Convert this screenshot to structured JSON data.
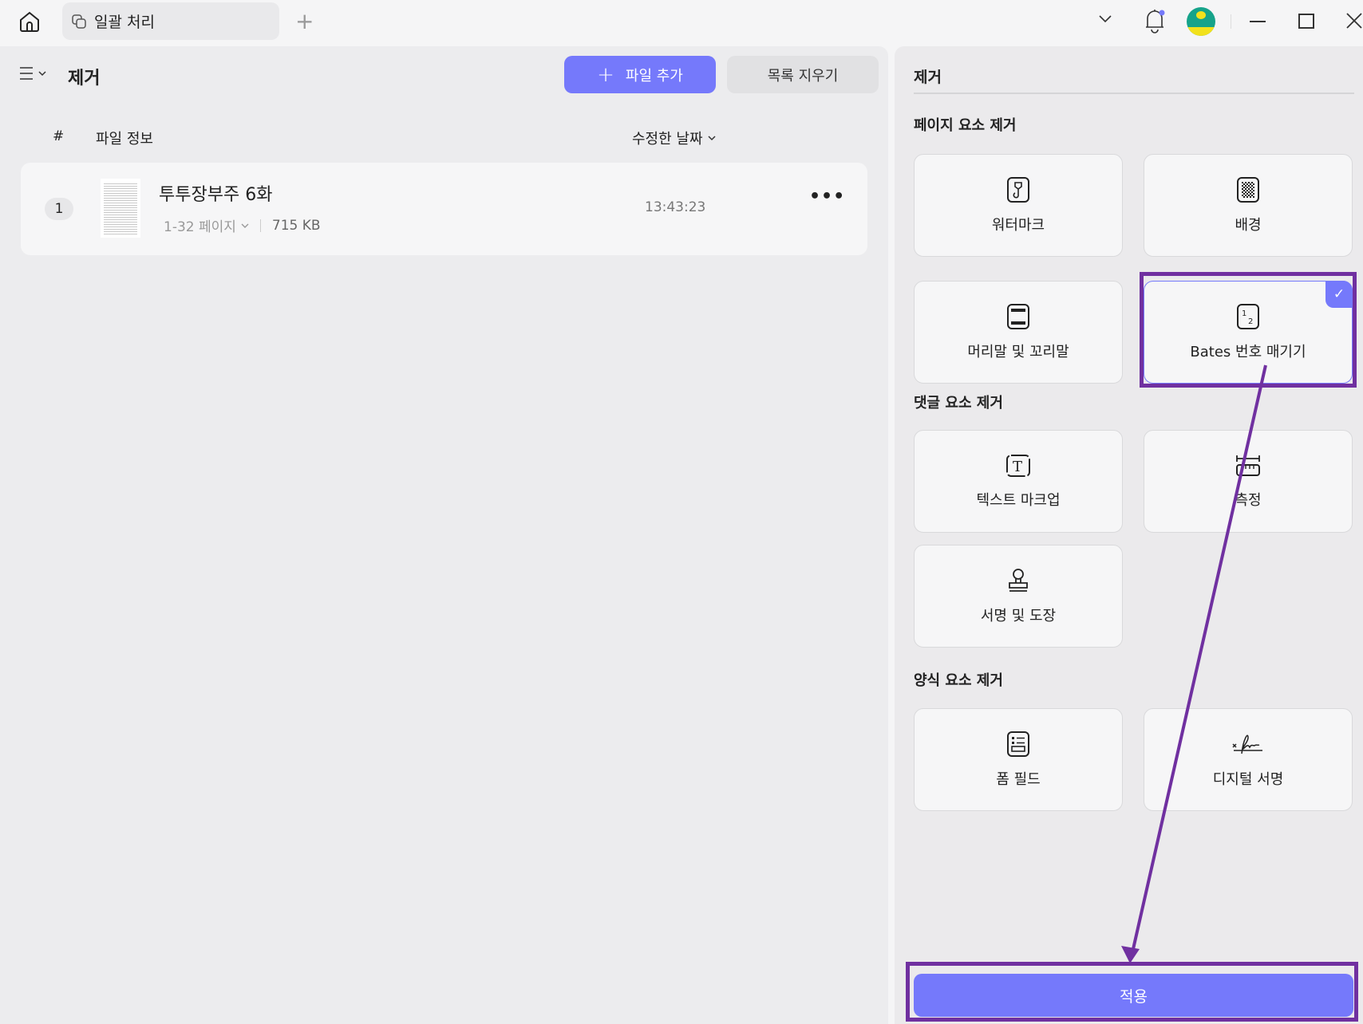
{
  "titlebar": {
    "tab_label": "일괄 처리"
  },
  "left": {
    "title": "제거",
    "add_file_label": "파일 추가",
    "clear_list_label": "목록 지우기",
    "columns": {
      "index": "#",
      "file_info": "파일 정보",
      "modified": "수정한 날짜"
    },
    "files": [
      {
        "index": "1",
        "name": "투투장부주 6화",
        "pages": "1-32 페이지",
        "size": "715 KB",
        "time": "13:43:23"
      }
    ]
  },
  "right": {
    "title": "제거",
    "sections": [
      {
        "title": "페이지 요소 제거",
        "items": [
          "워터마크",
          "배경",
          "머리말 및 꼬리말",
          "Bates 번호 매기기"
        ]
      },
      {
        "title": "댓글 요소 제거",
        "items": [
          "텍스트 마크업",
          "측정",
          "서명 및 도장"
        ]
      },
      {
        "title": "양식 요소 제거",
        "items": [
          "폼 필드",
          "디지털 서명"
        ]
      }
    ],
    "selected": "Bates 번호 매기기",
    "apply_label": "적용"
  },
  "colors": {
    "accent": "#7579fb",
    "annotation": "#7030a0"
  }
}
